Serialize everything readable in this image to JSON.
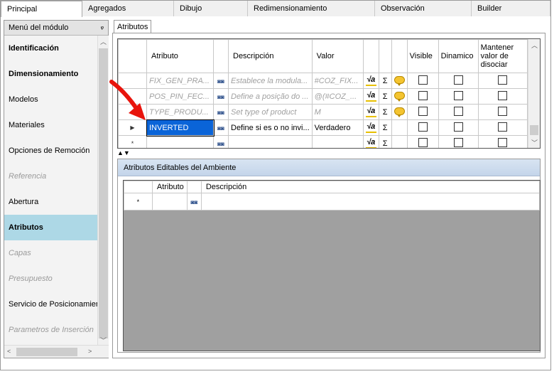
{
  "top_tabs": [
    "Principal",
    "Agregados",
    "Dibujo",
    "Redimensionamiento",
    "Observación",
    "Builder"
  ],
  "left_panel": {
    "title": "Menú del módulo",
    "pin": "ᵩ",
    "items": [
      {
        "label": "Identificación",
        "state": "bold"
      },
      {
        "label": "Dimensionamiento",
        "state": "bold"
      },
      {
        "label": "Modelos",
        "state": "normal"
      },
      {
        "label": "Materiales",
        "state": "normal"
      },
      {
        "label": "Opciones de Remoción",
        "state": "normal"
      },
      {
        "label": "Referencia",
        "state": "disabled"
      },
      {
        "label": "Abertura",
        "state": "normal"
      },
      {
        "label": "Atributos",
        "state": "selected"
      },
      {
        "label": "Capas",
        "state": "disabled"
      },
      {
        "label": "Presupuesto",
        "state": "disabled"
      },
      {
        "label": "Servicio de Posicionamiento",
        "state": "normal"
      },
      {
        "label": "Parametros de Inserción",
        "state": "disabled"
      }
    ]
  },
  "inner_tab": "Atributos",
  "attr_grid": {
    "headers": {
      "attribute": "Atributo",
      "description": "Descripción",
      "value": "Valor",
      "visible": "Visible",
      "dynamic": "Dinamico",
      "keep": "Mantener valor de disociar"
    },
    "rows": [
      {
        "indicator": "",
        "attribute": "FIX_GEN_PRA...",
        "description": "Establece la modula...",
        "value": "#COZ_FIX...",
        "faded": true,
        "bubble": true
      },
      {
        "indicator": "",
        "attribute": "POS_PIN_FEC...",
        "description": "Define a posição do ...",
        "value": "@(#COZ_...",
        "faded": true,
        "bubble": true
      },
      {
        "indicator": "",
        "attribute": "TYPE_PRODU...",
        "description": "Set type of product",
        "value": "M",
        "faded": true,
        "bubble": true
      },
      {
        "indicator": "▶",
        "attribute": "INVERTED",
        "description": "Define si es o no invi...",
        "value": "Verdadero",
        "faded": false,
        "bubble": false,
        "editing": true
      },
      {
        "indicator": "*",
        "attribute": "",
        "description": "",
        "value": "",
        "faded": false,
        "bubble": false
      }
    ],
    "sigma": "Σ",
    "sqrt": "√a",
    "sort_arrows": "▲▼"
  },
  "env_group": {
    "title": "Atributos Editables del Ambiente",
    "headers": {
      "attribute": "Atributo",
      "description": "Descripción"
    },
    "new_row_indicator": "*"
  }
}
